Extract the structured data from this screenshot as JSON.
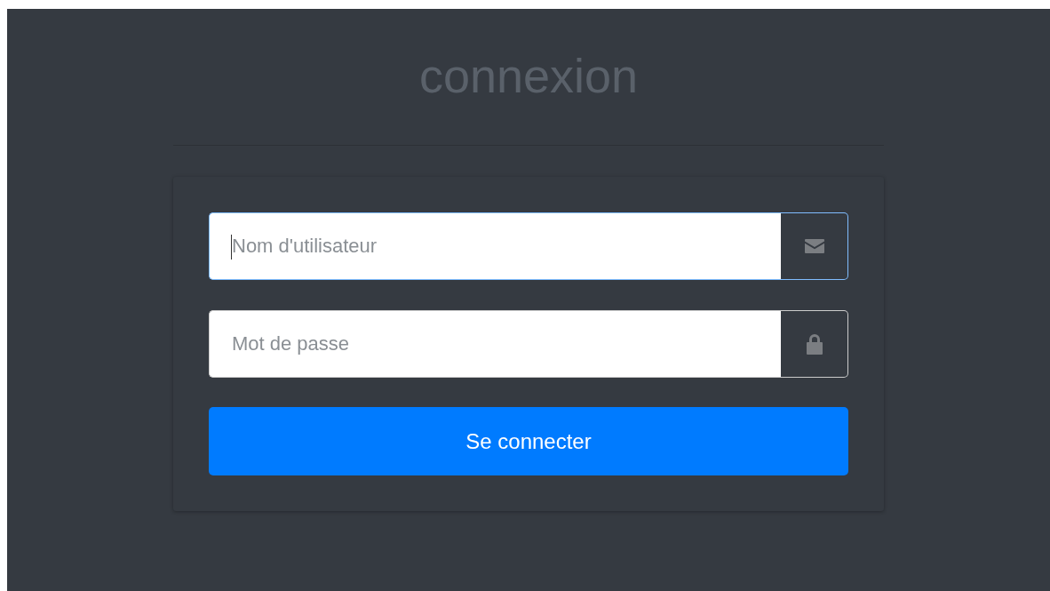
{
  "title": "connexion",
  "fields": [
    {
      "kind": "email",
      "placeholder": "Nom d'utilisateur",
      "focused": true
    },
    {
      "kind": "password",
      "placeholder": "Mot de passe",
      "focused": false
    }
  ],
  "submit_button": "Se connecter"
}
